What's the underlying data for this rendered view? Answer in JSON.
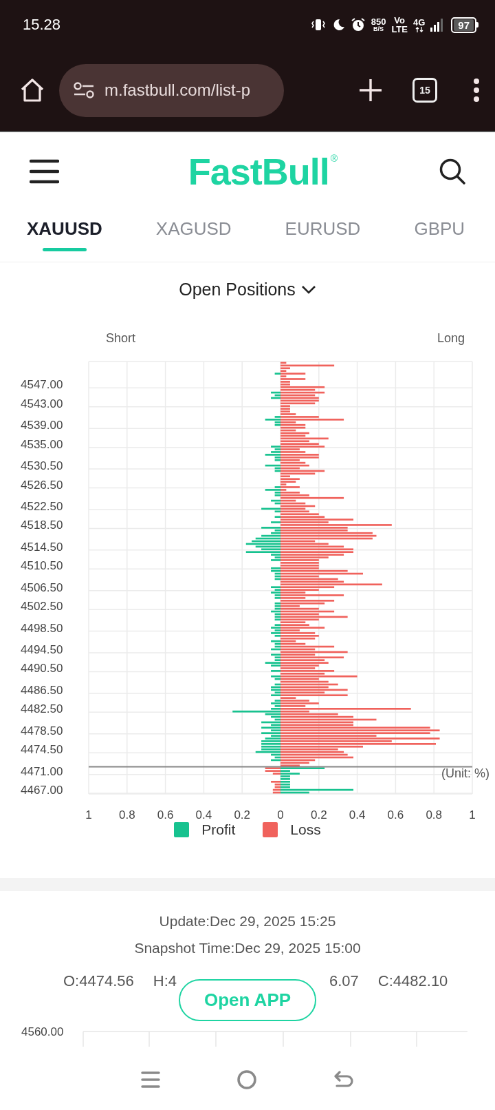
{
  "status_bar": {
    "time": "15.28",
    "net_speed": "850",
    "net_speed_unit": "B/S",
    "volte_top": "Vo",
    "volte_bottom": "LTE",
    "network": "4G",
    "battery": "97"
  },
  "browser": {
    "url": "m.fastbull.com/list-p",
    "tab_count": "15"
  },
  "header": {
    "logo": "FastBull$^{®}$"
  },
  "tabs": [
    {
      "label": "XAUUSD",
      "selected": true
    },
    {
      "label": "XAGUSD",
      "selected": false
    },
    {
      "label": "EURUSD",
      "selected": false
    },
    {
      "label": "GBPU",
      "selected": false
    }
  ],
  "positions": {
    "title": "Open Positions",
    "short_label": "Short",
    "long_label": "Long",
    "unit_label": "(Unit: %)",
    "chart_data": {
      "type": "bar",
      "orientation": "horizontal",
      "stacked": true,
      "xlim": [
        -1,
        1
      ],
      "grid": true,
      "categories": [
        null,
        null,
        null,
        null,
        null,
        null,
        null,
        null,
        "4547.00",
        null,
        null,
        null,
        null,
        null,
        null,
        "4543.00",
        null,
        null,
        null,
        null,
        null,
        null,
        null,
        "4539.00",
        null,
        null,
        null,
        null,
        null,
        null,
        "4535.00",
        null,
        null,
        null,
        null,
        null,
        null,
        null,
        "4530.50",
        null,
        null,
        null,
        null,
        null,
        null,
        "4526.50",
        null,
        null,
        null,
        null,
        null,
        null,
        null,
        "4522.50",
        null,
        null,
        null,
        null,
        null,
        null,
        "4518.50",
        null,
        null,
        null,
        null,
        null,
        null,
        null,
        "4514.50",
        null,
        null,
        null,
        null,
        null,
        null,
        "4510.50",
        null,
        null,
        null,
        null,
        null,
        null,
        null,
        "4506.50",
        null,
        null,
        null,
        null,
        null,
        null,
        "4502.50",
        null,
        null,
        null,
        null,
        null,
        null,
        null,
        "4498.50",
        null,
        null,
        null,
        null,
        null,
        null,
        null,
        "4494.50",
        null,
        null,
        null,
        null,
        null,
        null,
        "4490.50",
        null,
        null,
        null,
        null,
        null,
        null,
        null,
        "4486.50",
        null,
        null,
        null,
        null,
        null,
        null,
        "4482.50",
        null,
        null,
        null,
        null,
        null,
        null,
        null,
        "4478.50",
        null,
        null,
        null,
        null,
        null,
        null,
        "4474.50",
        null,
        null,
        null,
        null,
        null,
        null,
        null,
        "4471.00",
        null,
        null,
        null,
        null,
        null,
        null,
        "4467.00",
        null
      ],
      "xticks": [
        {
          "value": -1,
          "label": "1"
        },
        {
          "value": -0.8,
          "label": "0.8"
        },
        {
          "value": -0.6,
          "label": "0.6"
        },
        {
          "value": -0.4,
          "label": "0.4"
        },
        {
          "value": -0.2,
          "label": "0.2"
        },
        {
          "value": 0,
          "label": "0"
        },
        {
          "value": 0.2,
          "label": "0.2"
        },
        {
          "value": 0.4,
          "label": "0.4"
        },
        {
          "value": 0.6,
          "label": "0.6"
        },
        {
          "value": 0.8,
          "label": "0.8"
        },
        {
          "value": 1,
          "label": "1"
        }
      ],
      "series": [
        {
          "name": "Profit",
          "color": "#17c28f",
          "values": [
            0,
            0,
            0,
            0,
            -0.03,
            0,
            0,
            0,
            0,
            0,
            0,
            -0.05,
            -0.03,
            -0.05,
            0,
            0,
            0,
            0,
            0,
            0,
            -0.03,
            -0.08,
            -0.03,
            -0.03,
            0,
            0,
            0,
            0,
            0,
            0,
            0,
            -0.05,
            -0.03,
            -0.05,
            -0.08,
            -0.03,
            -0.03,
            0,
            -0.08,
            -0.03,
            -0.03,
            0,
            0,
            0,
            0,
            0,
            -0.03,
            -0.08,
            -0.03,
            -0.03,
            0,
            -0.05,
            -0.03,
            0,
            -0.1,
            -0.03,
            0,
            -0.03,
            0,
            -0.05,
            0,
            -0.1,
            -0.03,
            -0.05,
            -0.1,
            -0.13,
            -0.15,
            -0.18,
            -0.13,
            -0.1,
            -0.18,
            -0.05,
            -0.03,
            -0.05,
            0,
            0,
            -0.05,
            -0.05,
            -0.03,
            -0.03,
            -0.03,
            0,
            0,
            -0.05,
            -0.03,
            -0.05,
            -0.03,
            -0.03,
            0,
            -0.03,
            -0.03,
            -0.03,
            -0.05,
            -0.03,
            -0.03,
            -0.03,
            0,
            -0.03,
            -0.05,
            -0.03,
            -0.05,
            -0.03,
            0,
            -0.05,
            -0.03,
            -0.03,
            -0.05,
            0,
            -0.05,
            -0.03,
            -0.03,
            -0.08,
            -0.05,
            0,
            -0.05,
            0,
            -0.05,
            -0.03,
            0,
            -0.03,
            -0.05,
            -0.05,
            -0.03,
            -0.05,
            0,
            -0.03,
            -0.05,
            -0.03,
            -0.05,
            -0.25,
            -0.08,
            -0.05,
            -0.03,
            -0.1,
            -0.05,
            -0.1,
            -0.05,
            -0.1,
            -0.05,
            -0.08,
            -0.1,
            -0.1,
            -0.1,
            -0.1,
            -0.13,
            -0.05,
            -0.03,
            -0.05,
            0,
            0,
            0.23,
            0.05,
            0.1,
            0.05,
            0.05,
            0.05,
            0.05,
            0.05,
            0.38,
            0.15
          ]
        },
        {
          "name": "Loss",
          "color": "#f0625c",
          "values": [
            0.03,
            0.28,
            0.05,
            0.03,
            0.13,
            0.03,
            0.13,
            0.05,
            0.05,
            0.23,
            0.18,
            0.23,
            0.18,
            0.2,
            0.2,
            0.18,
            0.05,
            0.05,
            0.05,
            0.08,
            0.2,
            0.33,
            0.08,
            0.13,
            0.13,
            0.08,
            0.15,
            0.13,
            0.25,
            0.15,
            0.2,
            0.23,
            0.1,
            0.13,
            0.2,
            0.2,
            0.1,
            0.13,
            0.15,
            0.1,
            0.23,
            0.18,
            0.05,
            0.1,
            0.08,
            0.03,
            0.1,
            0.03,
            0.1,
            0.15,
            0.33,
            0.08,
            0.13,
            0.18,
            0.13,
            0.15,
            0.2,
            0.23,
            0.38,
            0.25,
            0.58,
            0.35,
            0.35,
            0.48,
            0.5,
            0.48,
            0.18,
            0.25,
            0.33,
            0.38,
            0.38,
            0.33,
            0.25,
            0.2,
            0.2,
            0.2,
            0.2,
            0.35,
            0.43,
            0.2,
            0.3,
            0.33,
            0.53,
            0.28,
            0.2,
            0.13,
            0.33,
            0.13,
            0.28,
            0.23,
            0.1,
            0.2,
            0.28,
            0.2,
            0.35,
            0.2,
            0.13,
            0.15,
            0.23,
            0.1,
            0.18,
            0.2,
            0.18,
            0.08,
            0.13,
            0.28,
            0.18,
            0.35,
            0.18,
            0.33,
            0.23,
            0.25,
            0.2,
            0.18,
            0.28,
            0.23,
            0.4,
            0.2,
            0.25,
            0.3,
            0.25,
            0.35,
            0.23,
            0.35,
            0.08,
            0.15,
            0.2,
            0.13,
            0.68,
            0.15,
            0.3,
            0.38,
            0.5,
            0.38,
            0.38,
            0.78,
            0.83,
            0.78,
            0.5,
            0.83,
            0.58,
            0.81,
            0.43,
            0.3,
            0.33,
            0.35,
            0.38,
            0.18,
            0.15,
            0.1,
            -0.08,
            -0.08,
            -0.04,
            0,
            0,
            -0.05,
            -0.03,
            -0.03,
            -0.04,
            -0.04
          ]
        }
      ]
    }
  },
  "info": {
    "update": "Update:Dec 29, 2025 15:25",
    "snapshot": "Snapshot Time:Dec 29, 2025 15:00",
    "ohlc": [
      "O:4474.56",
      "H:4",
      "6.07",
      "C:4482.10"
    ],
    "open_app_button": "Open APP",
    "price_chart_label": "4560.00"
  }
}
